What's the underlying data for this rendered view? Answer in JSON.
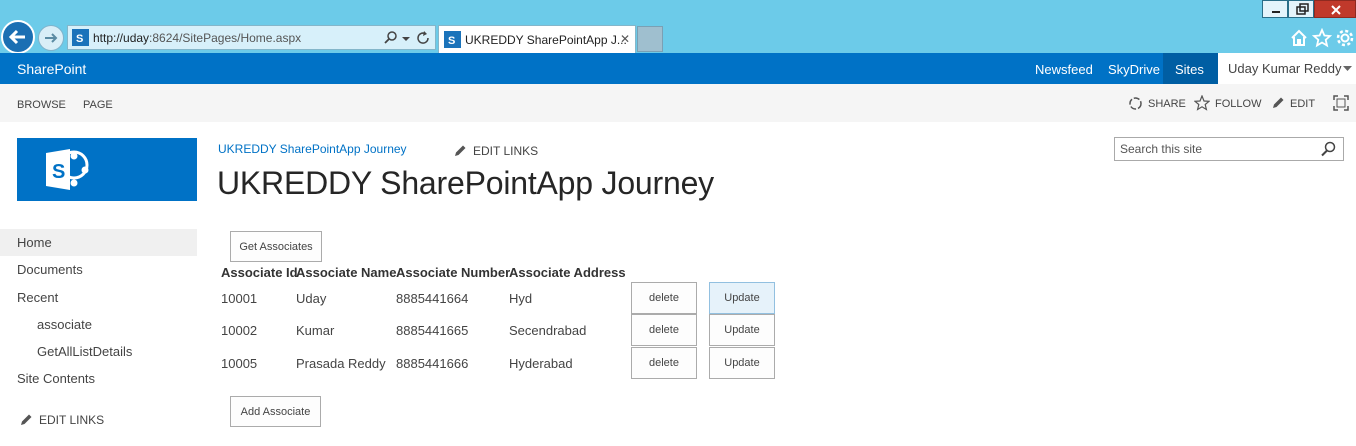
{
  "browser": {
    "url_host": "http://uday",
    "url_rest": ":8624/SitePages/Home.aspx",
    "tab_title": "UKREDDY SharePointApp J...",
    "tab_close": "✕"
  },
  "suitebar": {
    "brand": "SharePoint",
    "links": [
      "Newsfeed",
      "SkyDrive",
      "Sites"
    ],
    "user": "Uday Kumar Reddy",
    "accent": "#0072c6"
  },
  "ribbon": {
    "tabs": [
      "BROWSE",
      "PAGE"
    ],
    "actions": {
      "share": "SHARE",
      "follow": "FOLLOW",
      "edit": "EDIT"
    }
  },
  "header": {
    "breadcrumb": "UKREDDY SharePointApp Journey",
    "edit_links": "EDIT LINKS",
    "title": "UKREDDY SharePointApp Journey",
    "search_placeholder": "Search this site"
  },
  "quick_launch": {
    "items": [
      "Home",
      "Documents",
      "Recent",
      "associate",
      "GetAllListDetails",
      "Site Contents"
    ],
    "edit_links": "EDIT LINKS"
  },
  "main": {
    "get_button": "Get Associates",
    "add_button": "Add Associate",
    "columns": [
      "Associate Id",
      "Associate Name",
      "Associate Number",
      "Associate Address"
    ],
    "rows": [
      {
        "id": "10001",
        "name": "Uday",
        "number": "8885441664",
        "address": "Hyd",
        "delete": "delete",
        "update": "Update"
      },
      {
        "id": "10002",
        "name": "Kumar",
        "number": "8885441665",
        "address": "Secendrabad",
        "delete": "delete",
        "update": "Update"
      },
      {
        "id": "10005",
        "name": "Prasada Reddy",
        "number": "8885441666",
        "address": "Hyderabad",
        "delete": "delete",
        "update": "Update"
      }
    ]
  }
}
